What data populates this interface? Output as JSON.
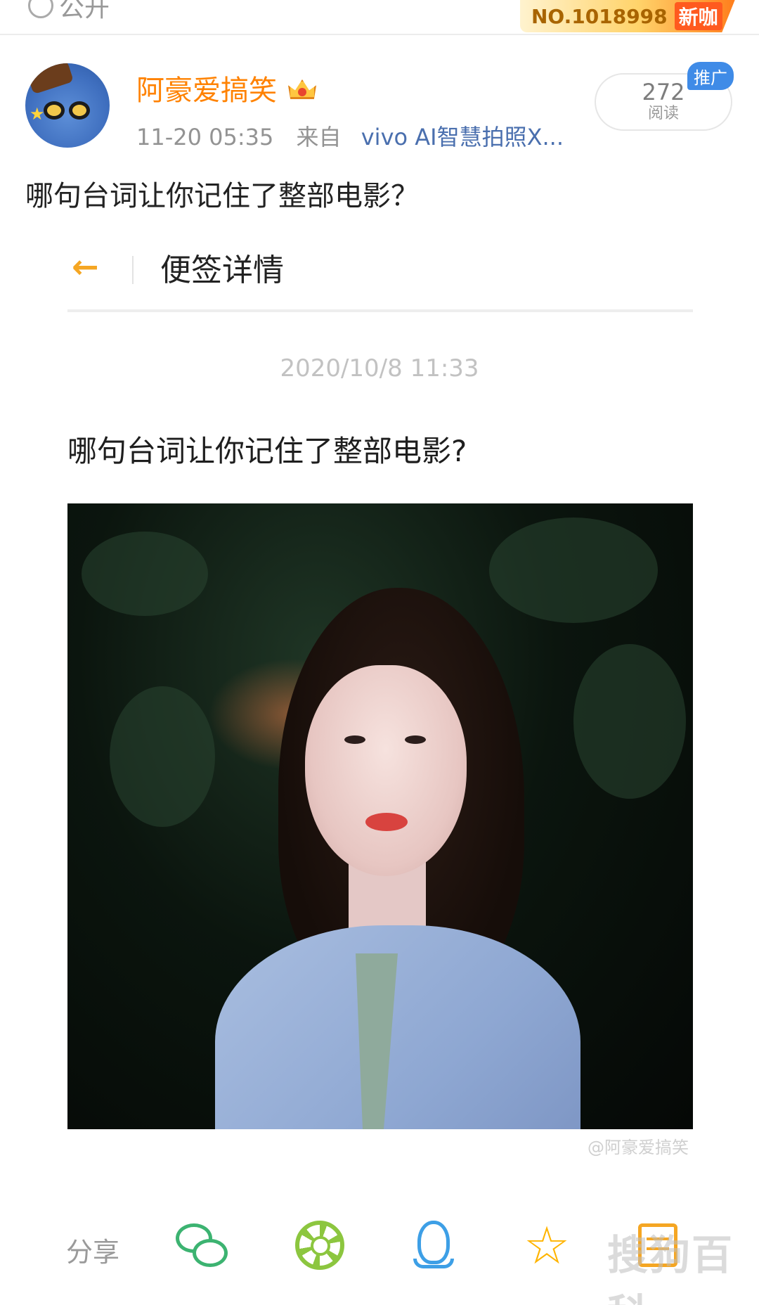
{
  "topbar": {
    "visibility_label": "公开",
    "rank_label": "NO.1018998",
    "rank_tag": "新咖"
  },
  "post": {
    "username": "阿豪爱搞笑",
    "time": "11-20 05:35",
    "from_label": "来自",
    "source": "vivo AI智慧拍照X...",
    "read_count": "272",
    "read_label": "阅读",
    "promo_badge": "推广",
    "text": "哪句台词让你记住了整部电影？"
  },
  "note_card": {
    "nav_title": "便签详情",
    "date": "2020/10/8 11:33",
    "title": "哪句台词让你记住了整部电影?",
    "watermark": "@阿豪爱搞笑"
  },
  "sharebar": {
    "label": "分享",
    "icons": [
      "wechat-icon",
      "moments-icon",
      "qq-icon",
      "favorite-icon",
      "more-icon"
    ],
    "overlay_watermark": "搜狗百科"
  },
  "colors": {
    "username": "#ff8200",
    "source": "#4a6fae",
    "promo": "#3f8be7",
    "back_arrow": "#f5a623"
  }
}
